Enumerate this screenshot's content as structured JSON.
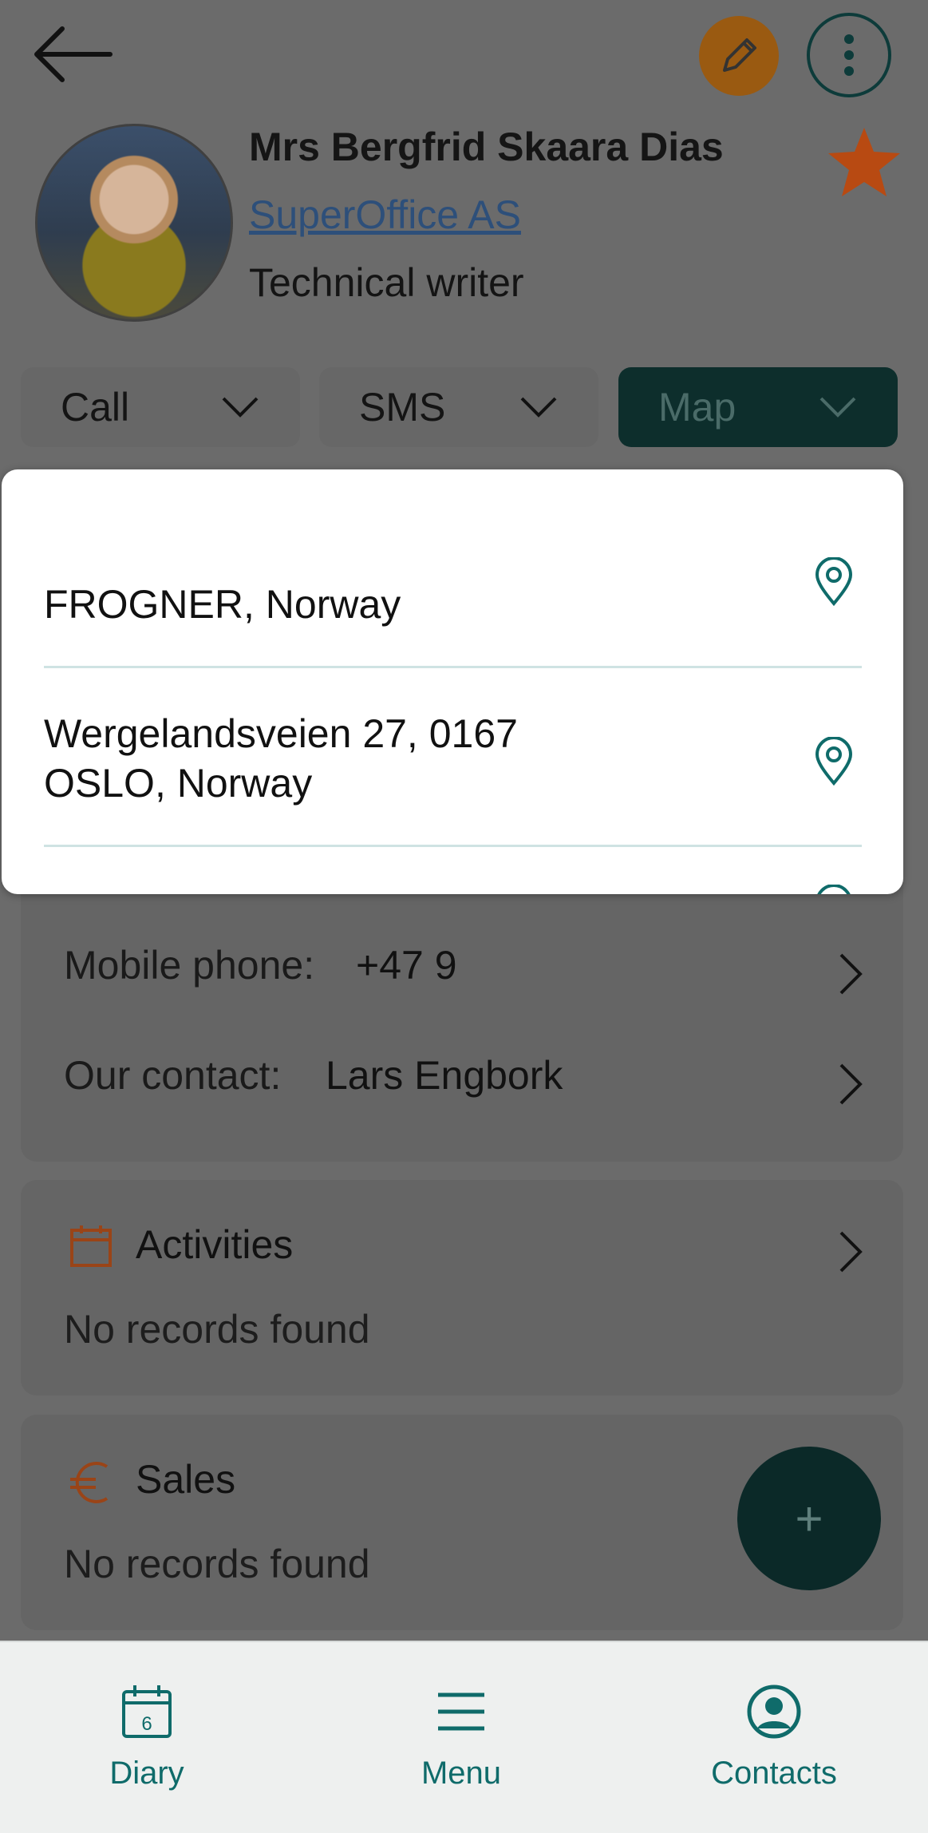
{
  "contact": {
    "name": "Mrs Bergfrid Skaara Dias",
    "company": "SuperOffice AS",
    "title": "Technical writer"
  },
  "actions": [
    {
      "label": "Call"
    },
    {
      "label": "SMS"
    },
    {
      "label": "Map"
    }
  ],
  "map_dropdown": {
    "addresses": [
      {
        "line1": "FROGNER, Norway",
        "line2": ""
      },
      {
        "line1": "Wergelandsveien 27, 0167",
        "line2": "OSLO, Norway"
      }
    ]
  },
  "details": {
    "mobile_label": "Mobile phone:",
    "mobile_value": "+47 9",
    "our_contact_label": "Our contact:",
    "our_contact_value": "Lars Engbork"
  },
  "activities": {
    "title": "Activities",
    "empty": "No records found"
  },
  "sales": {
    "title": "Sales",
    "empty": "No records found"
  },
  "fab_label": "+",
  "bottom_nav": [
    {
      "label": "Diary",
      "icon": "calendar-icon",
      "badge": "6"
    },
    {
      "label": "Menu",
      "icon": "menu-icon"
    },
    {
      "label": "Contacts",
      "icon": "contacts-icon"
    }
  ],
  "colors": {
    "accent": "#0f6b6a",
    "edit": "#9a5a11",
    "star": "#b84a12",
    "fab": "#0b2928"
  }
}
